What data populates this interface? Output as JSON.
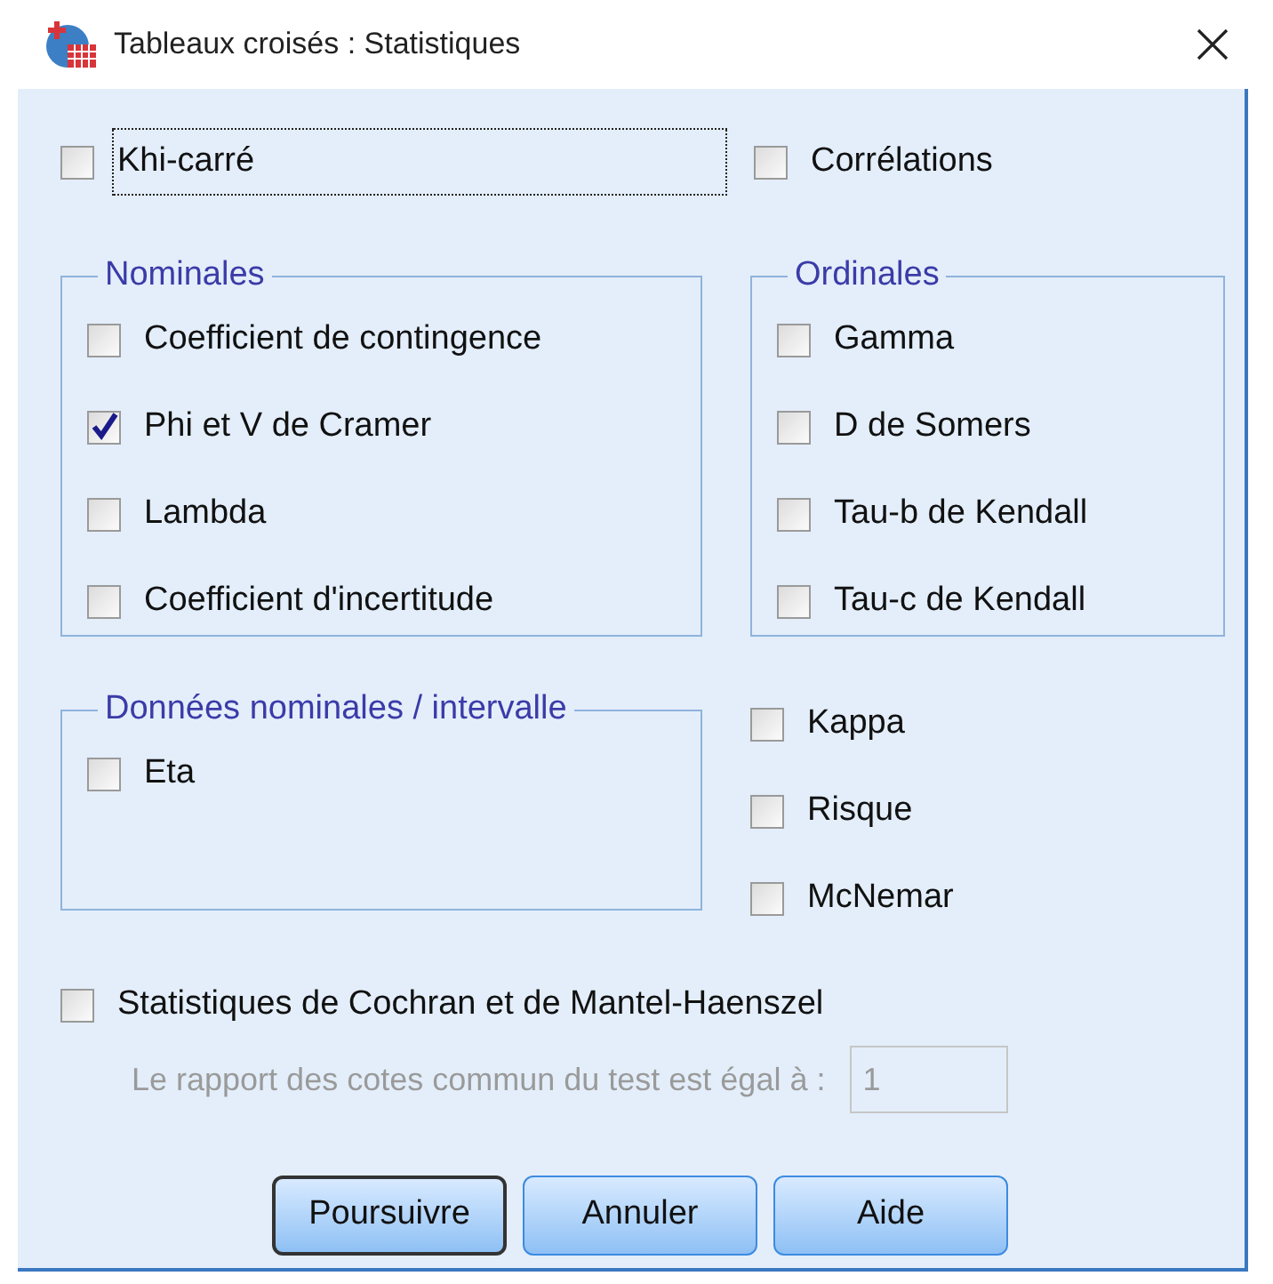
{
  "window": {
    "title": "Tableaux croisés : Statistiques"
  },
  "top_options": [
    {
      "label": "Khi-carré",
      "checked": false,
      "focused": true
    },
    {
      "label": "Corrélations",
      "checked": false,
      "focused": false
    }
  ],
  "groups": [
    {
      "title": "Nominales",
      "options": [
        {
          "label": "Coefficient de contingence",
          "checked": false
        },
        {
          "label": "Phi et V de Cramer",
          "checked": true
        },
        {
          "label": "Lambda",
          "checked": false
        },
        {
          "label": "Coefficient d'incertitude",
          "checked": false
        }
      ]
    },
    {
      "title": "Ordinales",
      "options": [
        {
          "label": "Gamma",
          "checked": false
        },
        {
          "label": "D de Somers",
          "checked": false
        },
        {
          "label": "Tau-b de Kendall",
          "checked": false
        },
        {
          "label": "Tau-c de Kendall",
          "checked": false
        }
      ]
    },
    {
      "title": "Données nominales / intervalle",
      "options": [
        {
          "label": "Eta",
          "checked": false
        }
      ]
    }
  ],
  "side_options": [
    {
      "label": "Kappa",
      "checked": false
    },
    {
      "label": "Risque",
      "checked": false
    },
    {
      "label": "McNemar",
      "checked": false
    }
  ],
  "cochran": {
    "label": "Statistiques de Cochran et de Mantel-Haenszel",
    "checked": false
  },
  "ratio": {
    "label": "Le rapport des cotes commun du test est égal à :",
    "value": "1",
    "disabled": true
  },
  "buttons": [
    {
      "label": "Poursuivre",
      "default": true
    },
    {
      "label": "Annuler",
      "default": false
    },
    {
      "label": "Aide",
      "default": false
    }
  ]
}
